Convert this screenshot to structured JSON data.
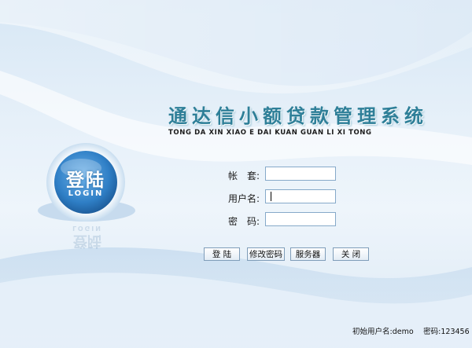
{
  "app": {
    "title": "通达信小额贷款管理系统",
    "subtitle": "TONG DA XIN XIAO E DAI KUAN GUAN LI XI TONG"
  },
  "logo": {
    "cn": "登陆",
    "en": "LOGIN"
  },
  "form": {
    "account_label": "帐　套:",
    "account_value": "",
    "username_label": "用户名:",
    "username_value": "",
    "password_label": "密　码:",
    "password_value": ""
  },
  "buttons": {
    "login": "登 陆",
    "change_password": "修改密码",
    "server": "服务器",
    "close": "关 闭"
  },
  "footer": {
    "hint": "初始用户名:demo　 密码:123456"
  },
  "colors": {
    "accent": "#2e7f98",
    "field_border": "#86a9c9",
    "logo_blue": "#3f8ed0"
  },
  "icons": [
    "login-logo-icon"
  ]
}
